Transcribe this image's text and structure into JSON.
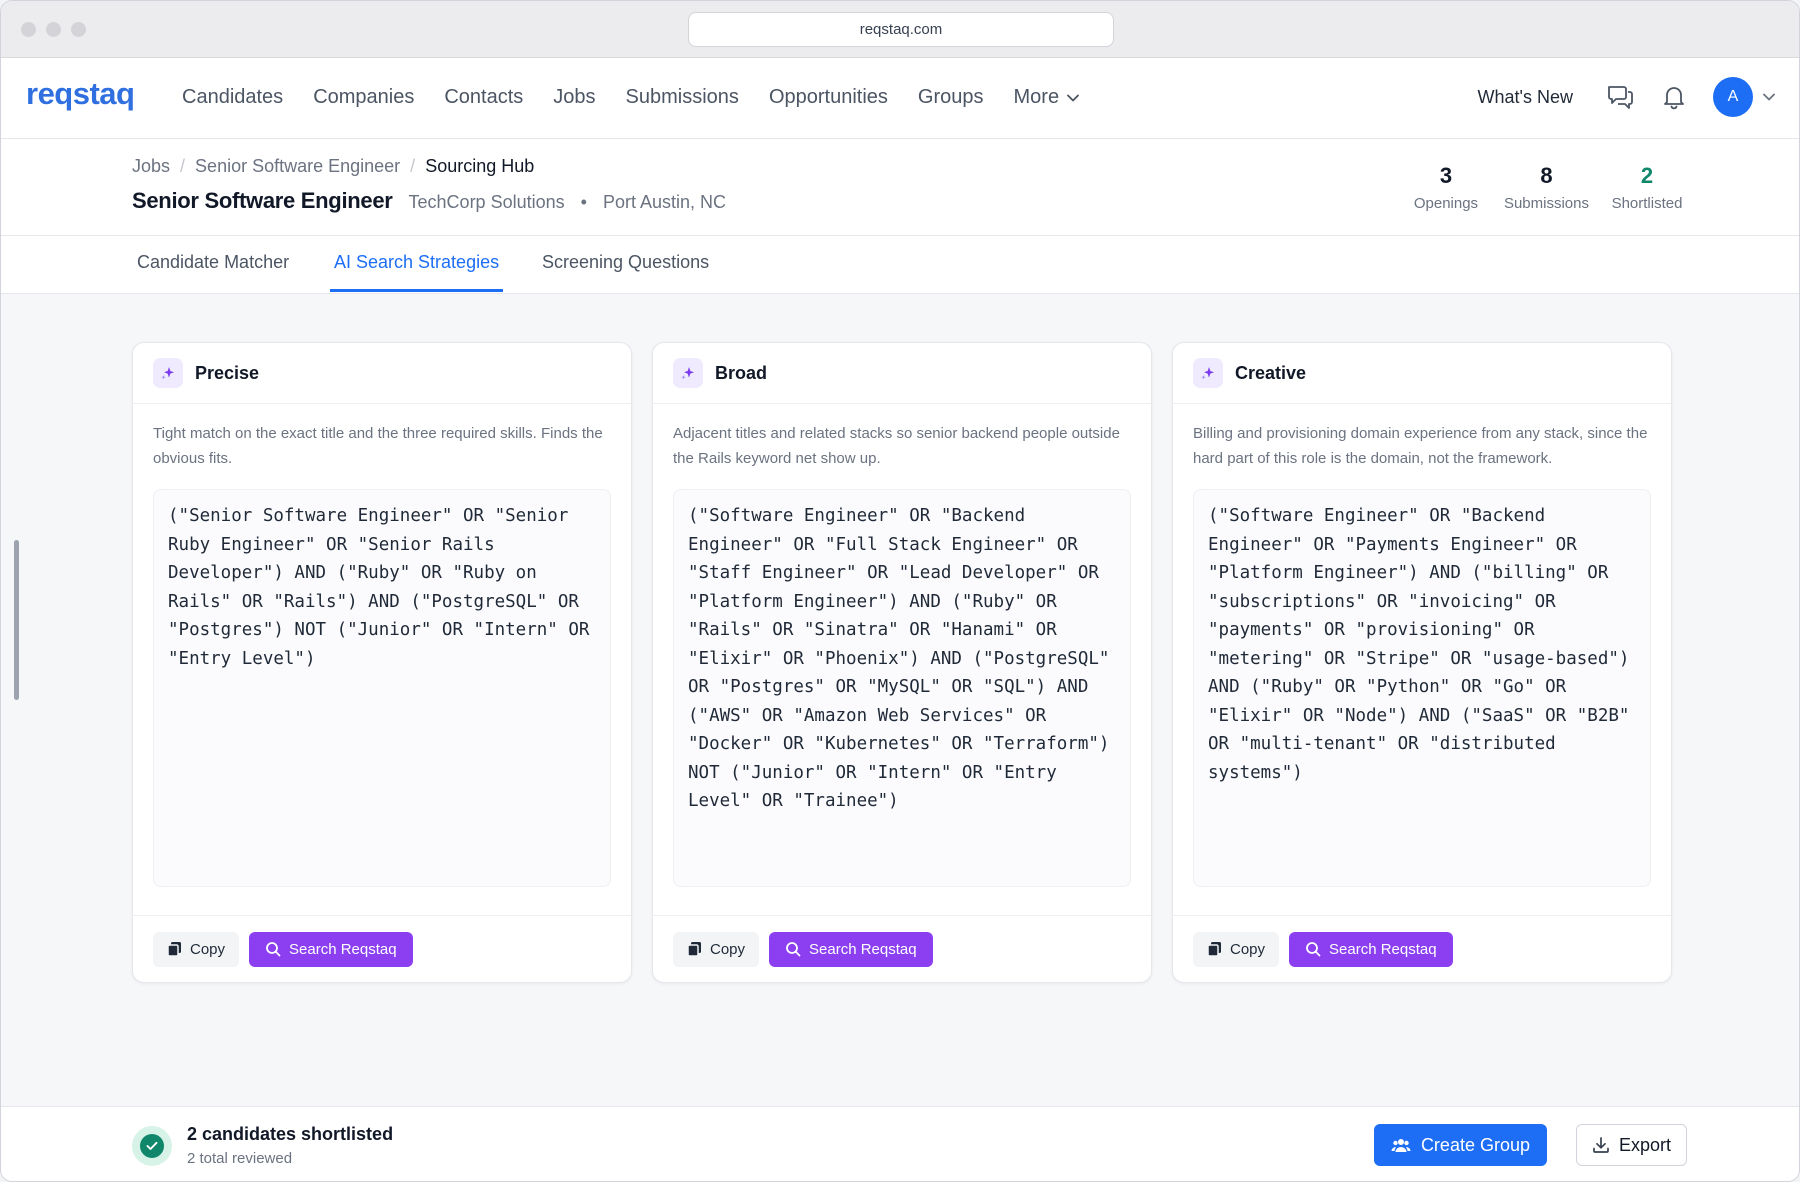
{
  "browser": {
    "url": "reqstaq.com"
  },
  "nav": {
    "logo": "reqstaq",
    "links": [
      "Candidates",
      "Companies",
      "Contacts",
      "Jobs",
      "Submissions",
      "Opportunities",
      "Groups"
    ],
    "more_label": "More",
    "whats_new": "What's New",
    "avatar_initial": "A"
  },
  "breadcrumb": {
    "items": [
      "Jobs",
      "Senior Software Engineer"
    ],
    "current": "Sourcing Hub"
  },
  "job": {
    "title": "Senior Software Engineer",
    "company": "TechCorp Solutions",
    "location": "Port Austin, NC"
  },
  "stats": [
    {
      "value": "3",
      "label": "Openings"
    },
    {
      "value": "8",
      "label": "Submissions"
    },
    {
      "value": "2",
      "label": "Shortlisted"
    }
  ],
  "tabs": [
    "Candidate Matcher",
    "AI Search Strategies",
    "Screening Questions"
  ],
  "active_tab": "AI Search Strategies",
  "strategies": [
    {
      "title": "Precise",
      "description": "Tight match on the exact title and the three required skills. Finds the obvious fits.",
      "query": "(\"Senior Software Engineer\" OR \"Senior Ruby Engineer\" OR \"Senior Rails Developer\") AND (\"Ruby\" OR \"Ruby on Rails\" OR \"Rails\") AND (\"PostgreSQL\" OR \"Postgres\") NOT (\"Junior\" OR \"Intern\" OR \"Entry Level\")",
      "copy_label": "Copy",
      "search_label": "Search Reqstaq"
    },
    {
      "title": "Broad",
      "description": "Adjacent titles and related stacks so senior backend people outside the Rails keyword net show up.",
      "query": "(\"Software Engineer\" OR \"Backend Engineer\" OR \"Full Stack Engineer\" OR \"Staff Engineer\" OR \"Lead Developer\" OR \"Platform Engineer\") AND (\"Ruby\" OR \"Rails\" OR \"Sinatra\" OR \"Hanami\" OR \"Elixir\" OR \"Phoenix\") AND (\"PostgreSQL\" OR \"Postgres\" OR \"MySQL\" OR \"SQL\") AND (\"AWS\" OR \"Amazon Web Services\" OR \"Docker\" OR \"Kubernetes\" OR \"Terraform\") NOT (\"Junior\" OR \"Intern\" OR \"Entry Level\" OR \"Trainee\")",
      "copy_label": "Copy",
      "search_label": "Search Reqstaq"
    },
    {
      "title": "Creative",
      "description": "Billing and provisioning domain experience from any stack, since the hard part of this role is the domain, not the framework.",
      "query": "(\"Software Engineer\" OR \"Backend Engineer\" OR \"Payments Engineer\" OR \"Platform Engineer\") AND (\"billing\" OR \"subscriptions\" OR \"invoicing\" OR \"payments\" OR \"provisioning\" OR \"metering\" OR \"Stripe\" OR \"usage-based\") AND (\"Ruby\" OR \"Python\" OR \"Go\" OR \"Elixir\" OR \"Node\") AND (\"SaaS\" OR \"B2B\" OR \"multi-tenant\" OR \"distributed systems\")",
      "copy_label": "Copy",
      "search_label": "Search Reqstaq"
    }
  ],
  "bottom": {
    "title": "2 candidates shortlisted",
    "subtitle": "2 total reviewed",
    "create_group": "Create Group",
    "export": "Export"
  },
  "colors": {
    "brand": "#2f6fe0",
    "primary": "#1d6ef5",
    "accent_purple": "#8b3ff0",
    "success": "#10876b"
  }
}
